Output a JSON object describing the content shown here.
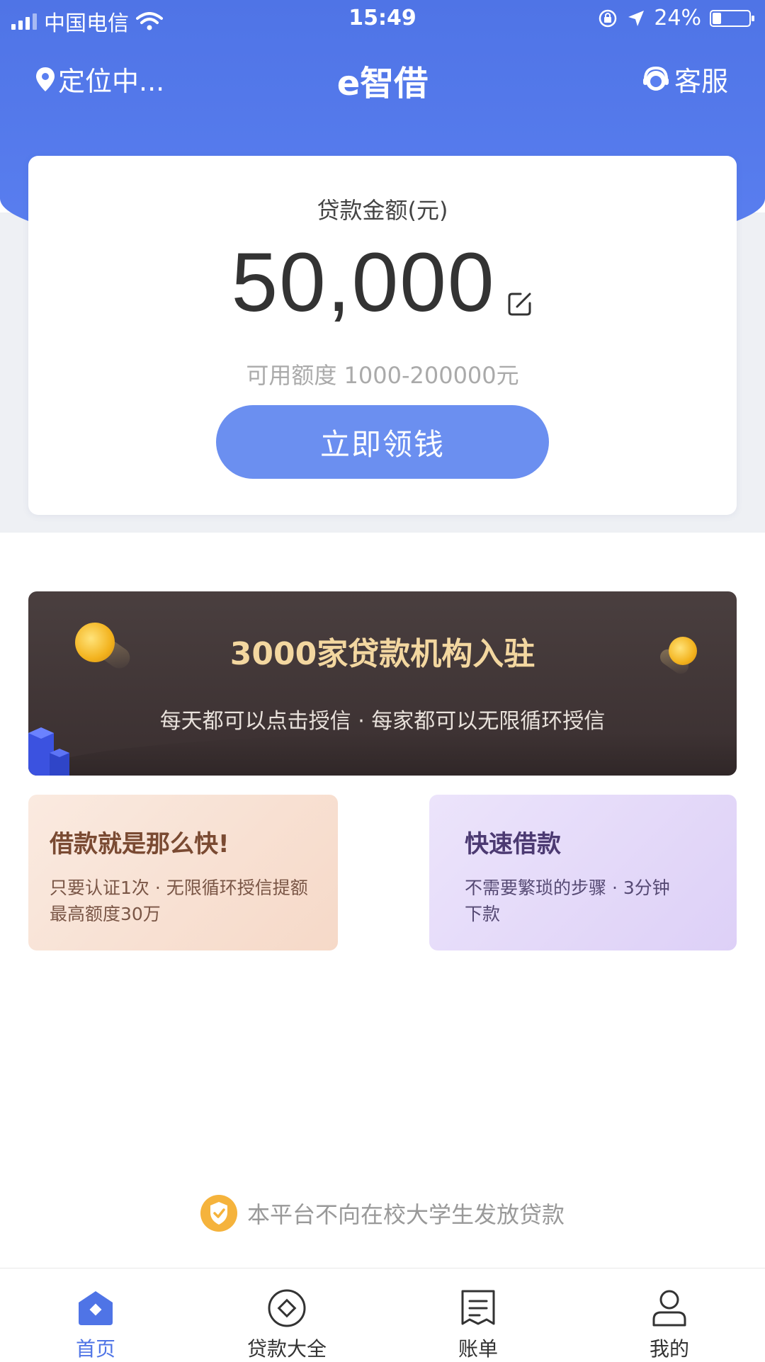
{
  "status_bar": {
    "carrier": "中国电信",
    "time": "15:49",
    "battery": "24%",
    "battery_level": 0.24
  },
  "nav": {
    "location": "定位中...",
    "title": "e智借",
    "service": "客服"
  },
  "loan_card": {
    "label": "贷款金额(元)",
    "amount": "50,000",
    "range": "可用额度 1000-200000元",
    "cta": "立即领钱"
  },
  "banner": {
    "title": "3000家贷款机构入驻",
    "subtitle": "每天都可以点击授信 · 每家都可以无限循环授信"
  },
  "features": [
    {
      "title": "借款就是那么快!",
      "line1": "只要认证1次 · 无限循环授信提额",
      "line2": "最高额度30万"
    },
    {
      "title": "快速借款",
      "line1": "不需要繁琐的步骤 · 3分钟",
      "line2": "下款"
    }
  ],
  "notice": "本平台不向在校大学生发放贷款",
  "tabs": [
    {
      "label": "首页",
      "icon": "home-icon",
      "active": true
    },
    {
      "label": "贷款大全",
      "icon": "loan-list-icon",
      "active": false
    },
    {
      "label": "账单",
      "icon": "bill-icon",
      "active": false
    },
    {
      "label": "我的",
      "icon": "user-icon",
      "active": false
    }
  ],
  "colors": {
    "primary": "#4f74e6",
    "cta": "#6b8ff0",
    "banner_bg": "#3f3435",
    "banner_title": "#f3d7a0",
    "notice_shield": "#f5b33c"
  }
}
